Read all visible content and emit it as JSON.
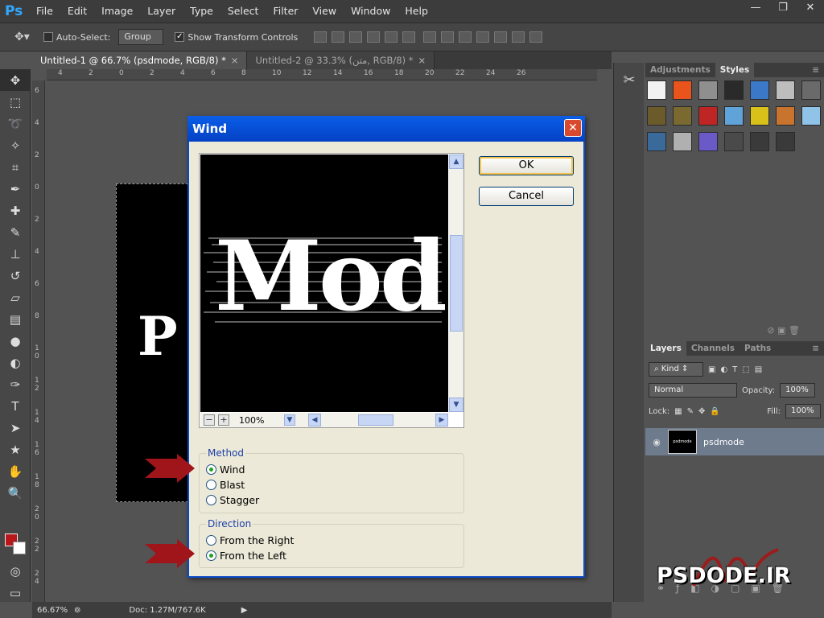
{
  "app": {
    "logo": "Ps"
  },
  "menu": [
    "File",
    "Edit",
    "Image",
    "Layer",
    "Type",
    "Select",
    "Filter",
    "View",
    "Window",
    "Help"
  ],
  "window_controls": {
    "minimize": "—",
    "restore": "❐",
    "close": "✕"
  },
  "options": {
    "auto_select_label": "Auto-Select:",
    "group_value": "Group",
    "show_transform_label": "Show Transform Controls",
    "show_transform_checked": "✓"
  },
  "tabs": [
    {
      "label": "Untitled-1 @ 66.7% (psdmode, RGB/8) *",
      "close": "×"
    },
    {
      "label": "Untitled-2 @ 33.3% (متن, RGB/8) *",
      "close": "×"
    }
  ],
  "ruler_h": [
    "4",
    "2",
    "0",
    "2",
    "4",
    "6",
    "8",
    "10",
    "12",
    "14",
    "16",
    "18",
    "20",
    "22",
    "24",
    "26"
  ],
  "ruler_v": [
    "6",
    "4",
    "2",
    "0",
    "2",
    "4",
    "6",
    "8",
    "1\n0",
    "1\n2",
    "1\n4",
    "1\n6",
    "1\n8",
    "2\n0",
    "2\n2",
    "2\n4"
  ],
  "canvas_text": "P",
  "status": {
    "zoom": "66.67%",
    "doc": "Doc: 1.27M/767.6K"
  },
  "panels": {
    "adjustments_tab": "Adjustments",
    "styles_tab": "Styles",
    "layers_tab": "Layers",
    "channels_tab": "Channels",
    "paths_tab": "Paths",
    "kind_label": "Kind",
    "blend_mode": "Normal",
    "opacity_label": "Opacity:",
    "opacity_value": "100%",
    "lock_label": "Lock:",
    "fill_label": "Fill:",
    "fill_value": "100%",
    "layer_name": "psdmode",
    "layer_thumb_text": "psdmode"
  },
  "style_colors": [
    "#f2f2f2",
    "#e8541b",
    "#8f8f8f",
    "#2a2a2a",
    "#3b78c8",
    "#bdbdbd",
    "#6a6a6a",
    "#6b5a2a",
    "#7a6a30",
    "#c02525",
    "#5fa3d8",
    "#d8c21a",
    "#c8742e",
    "#8fc3e8",
    "#3a6a9a",
    "#b0b0b0",
    "#6a5ac8",
    "#4a4a4a",
    "#3a3a3a",
    "#3a3a3a"
  ],
  "watermark": "PSDODE.IR",
  "dialog": {
    "title": "Wind",
    "close": "✕",
    "ok": "OK",
    "cancel": "Cancel",
    "preview_text": "Mod",
    "zoom": "100%",
    "zoom_out": "−",
    "zoom_in": "+",
    "method_legend": "Method",
    "method_options": [
      "Wind",
      "Blast",
      "Stagger"
    ],
    "method_selected": "Wind",
    "direction_legend": "Direction",
    "direction_options": [
      "From the Right",
      "From the Left"
    ],
    "direction_selected": "From the Left"
  },
  "colors": {
    "foreground": "#b8181b",
    "background": "#ffffff",
    "xp_title": "#0a5ee8",
    "arrow": "#a0151a"
  }
}
